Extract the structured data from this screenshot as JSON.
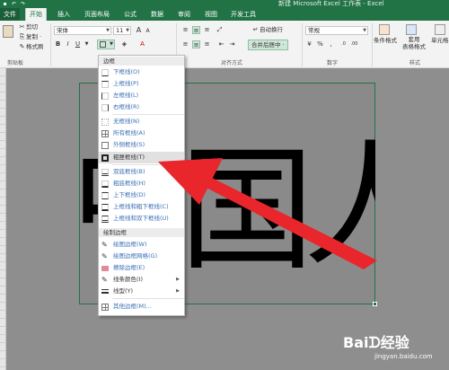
{
  "window": {
    "title": "新建 Microsoft Excel 工作表 - Excel"
  },
  "tabs": [
    {
      "label": "文件"
    },
    {
      "label": "开始"
    },
    {
      "label": "插入"
    },
    {
      "label": "页面布局"
    },
    {
      "label": "公式"
    },
    {
      "label": "数据"
    },
    {
      "label": "审阅"
    },
    {
      "label": "视图"
    },
    {
      "label": "开发工具"
    }
  ],
  "ribbon": {
    "clipboard": {
      "cut": "剪切",
      "copy": "复制 ·",
      "format_painter": "格式刷",
      "label": "剪贴板"
    },
    "font": {
      "name": "宋体",
      "size": "11",
      "bold": "B",
      "italic": "I",
      "underline": "U"
    },
    "alignment": {
      "wrap_text": "自动换行",
      "merge_center": "合并后居中 ·",
      "label": "对齐方式"
    },
    "number": {
      "format": "常规",
      "percent": "%",
      "comma": ",",
      "label": "数字"
    },
    "styles": {
      "conditional": "条件格式",
      "table_format": "套用\n表格格式",
      "cell_styles": "单元格",
      "label": "样式"
    }
  },
  "menu": {
    "header_borders": "边框",
    "items": [
      {
        "label": "下框线(O)"
      },
      {
        "label": "上框线(P)"
      },
      {
        "label": "左框线(L)"
      },
      {
        "label": "右框线(R)"
      },
      {
        "label": "无框线(N)"
      },
      {
        "label": "所有框线(A)"
      },
      {
        "label": "外侧框线(S)"
      },
      {
        "label": "粗匣框线(T)"
      },
      {
        "label": "双底框线(B)"
      },
      {
        "label": "粗底框线(H)"
      },
      {
        "label": "上下框线(D)"
      },
      {
        "label": "上框线和粗下框线(C)"
      },
      {
        "label": "上框线和双下框线(U)"
      }
    ],
    "header_draw": "绘制边框",
    "draw_items": [
      {
        "label": "绘图边框(W)"
      },
      {
        "label": "绘图边框网格(G)"
      },
      {
        "label": "擦除边框(E)"
      },
      {
        "label": "线条颜色(I)"
      },
      {
        "label": "线型(Y)"
      }
    ],
    "more": "其他边框(M)..."
  },
  "sheet": {
    "chars": [
      "中",
      "国",
      "人"
    ]
  },
  "watermark": {
    "brand": "Baiᗪ经验",
    "url": "jingyan.baidu.com"
  },
  "colors": {
    "excel_green": "#217346",
    "arrow_red": "#e8262b"
  }
}
